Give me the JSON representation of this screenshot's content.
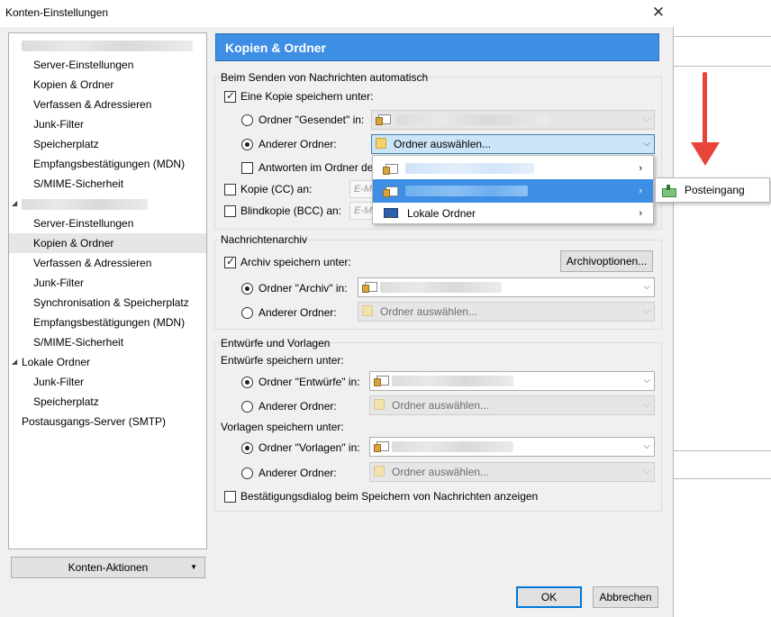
{
  "window": {
    "title": "Konten-Einstellungen",
    "close_glyph": "✕"
  },
  "sidebar": {
    "account1": {
      "items": [
        "Server-Einstellungen",
        "Kopien & Ordner",
        "Verfassen & Adressieren",
        "Junk-Filter",
        "Speicherplatz",
        "Empfangsbestätigungen (MDN)",
        "S/MIME-Sicherheit"
      ]
    },
    "account2": {
      "items": [
        "Server-Einstellungen",
        "Kopien & Ordner",
        "Verfassen & Adressieren",
        "Junk-Filter",
        "Synchronisation & Speicherplatz",
        "Empfangsbestätigungen (MDN)",
        "S/MIME-Sicherheit"
      ]
    },
    "local": {
      "label": "Lokale Ordner",
      "items": [
        "Junk-Filter",
        "Speicherplatz"
      ]
    },
    "smtp": "Postausgangs-Server (SMTP)",
    "actions_button": "Konten-Aktionen"
  },
  "panel": {
    "title": "Kopien & Ordner",
    "send": {
      "group_label": "Beim Senden von Nachrichten automatisch",
      "save_copy": "Eine Kopie speichern unter:",
      "folder_sent": "Ordner \"Gesendet\" in:",
      "other_folder": "Anderer Ordner:",
      "select_folder": "Ordner auswählen...",
      "reply_in_folder": "Antworten im Ordner de",
      "cc": "Kopie (CC) an:",
      "bcc": "Blindkopie (BCC) an:",
      "email_placeholder": "E-M"
    },
    "archive": {
      "group_label": "Nachrichtenarchiv",
      "save_archive": "Archiv speichern unter:",
      "options_button": "Archivoptionen...",
      "folder_archive": "Ordner \"Archiv\" in:",
      "other_folder": "Anderer Ordner:",
      "select_folder": "Ordner auswählen..."
    },
    "drafts": {
      "group_label": "Entwürfe und Vorlagen",
      "drafts_label": "Entwürfe speichern unter:",
      "folder_drafts": "Ordner \"Entwürfe\" in:",
      "other_folder": "Anderer Ordner:",
      "select_folder": "Ordner auswählen...",
      "templates_label": "Vorlagen speichern unter:",
      "folder_templates": "Ordner \"Vorlagen\" in:",
      "other_folder2": "Anderer Ordner:",
      "select_folder2": "Ordner auswählen...",
      "confirm_dialog": "Bestätigungsdialog beim Speichern von Nachrichten anzeigen"
    }
  },
  "popup": {
    "local_folders": "Lokale Ordner",
    "chevron": "›",
    "submenu_item": "Posteingang"
  },
  "footer": {
    "ok": "OK",
    "cancel": "Abbrechen"
  },
  "colors": {
    "accent": "#3d8ee4",
    "arrow": "#e8443a"
  },
  "icons": {
    "folder": "folder-icon",
    "account": "mail-account-icon",
    "local": "local-folders-icon",
    "inbox": "inbox-icon"
  }
}
